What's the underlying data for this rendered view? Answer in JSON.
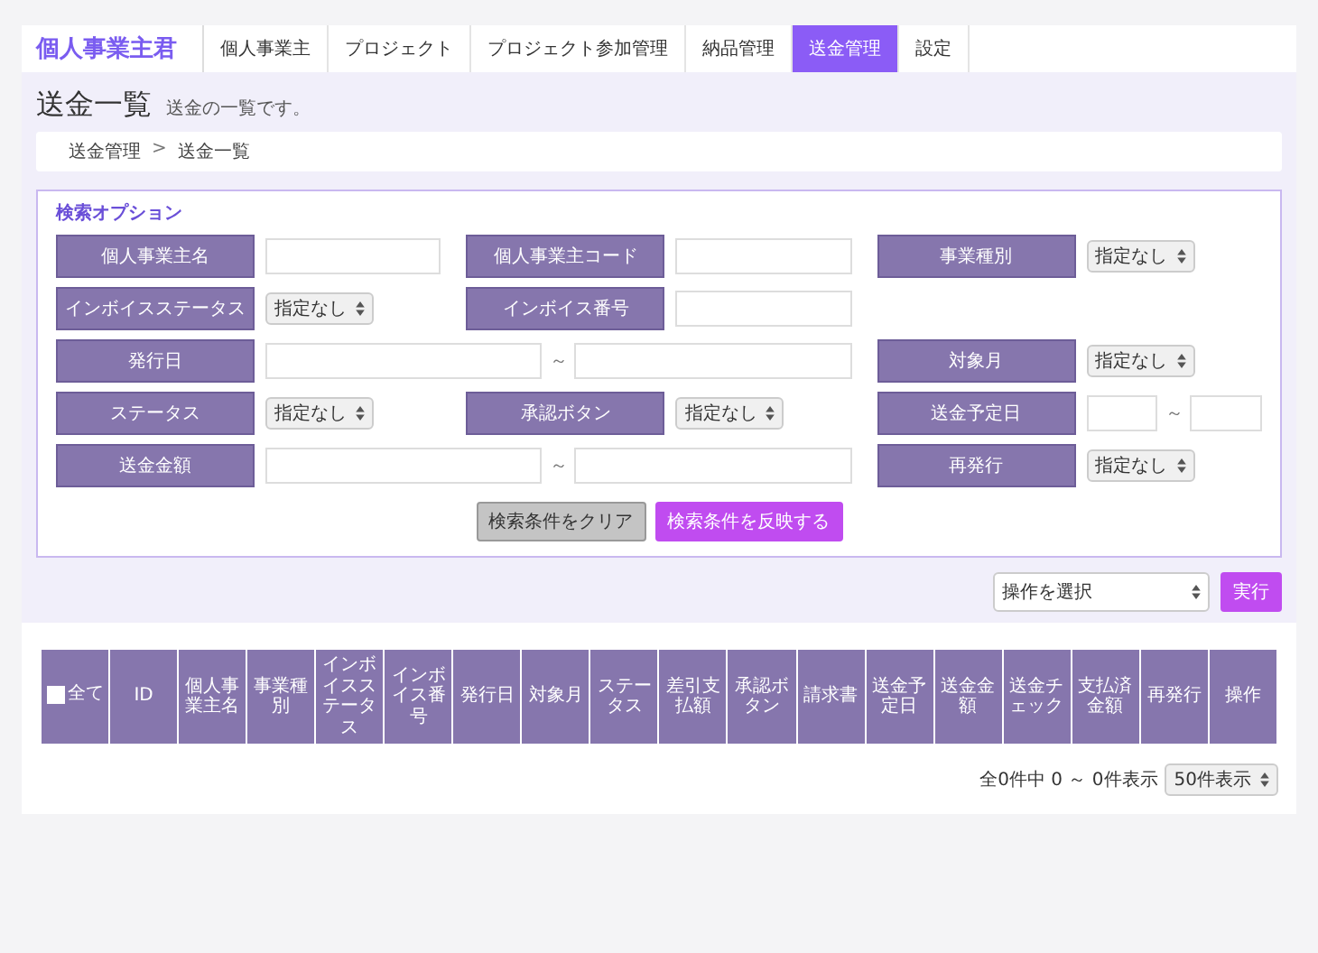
{
  "header": {
    "logo": "個人事業主君",
    "tabs": [
      {
        "label": "個人事業主",
        "selected": false
      },
      {
        "label": "プロジェクト",
        "selected": false
      },
      {
        "label": "プロジェクト参加管理",
        "selected": false
      },
      {
        "label": "納品管理",
        "selected": false
      },
      {
        "label": "送金管理",
        "selected": true
      },
      {
        "label": "設定",
        "selected": false
      }
    ]
  },
  "page": {
    "title": "送金一覧",
    "subtitle": "送金の一覧です。",
    "breadcrumb": [
      "送金管理",
      "送金一覧"
    ],
    "breadcrumb_separator": ">"
  },
  "search": {
    "heading": "検索オプション",
    "rows": [
      [
        {
          "label": "個人事業主名",
          "kind": "text"
        },
        {
          "label": "個人事業主コード",
          "kind": "text"
        },
        {
          "label": "事業種別",
          "kind": "select",
          "value": "指定なし"
        }
      ],
      [
        {
          "label": "インボイスステータス",
          "kind": "select",
          "value": "指定なし"
        },
        {
          "label": "インボイス番号",
          "kind": "text"
        }
      ],
      [
        {
          "label": "発行日",
          "kind": "range",
          "separator": "～"
        },
        {
          "label": "対象月",
          "kind": "select",
          "value": "指定なし"
        }
      ],
      [
        {
          "label": "ステータス",
          "kind": "select",
          "value": "指定なし"
        },
        {
          "label": "承認ボタン",
          "kind": "select",
          "value": "指定なし"
        },
        {
          "label": "送金予定日",
          "kind": "range",
          "separator": "～"
        }
      ],
      [
        {
          "label": "送金金額",
          "kind": "range",
          "separator": "～"
        },
        {
          "label": "再発行",
          "kind": "select",
          "value": "指定なし"
        }
      ]
    ],
    "buttons": [
      {
        "label": "検索条件をクリア",
        "kind": "secondary"
      },
      {
        "label": "検索条件を反映する",
        "kind": "primary"
      }
    ]
  },
  "bulk_action": {
    "select": "操作を選択",
    "button": "実行"
  },
  "table": {
    "select_all": {
      "label": "全て",
      "checked": false
    },
    "columns": [
      "ID",
      "個人事業主名",
      "事業種別",
      "インボイスステータス",
      "インボイス番号",
      "発行日",
      "対象月",
      "ステータス",
      "差引支払額",
      "承認ボタン",
      "請求書",
      "送金予定日",
      "送金金額",
      "送金チェック",
      "支払済金額",
      "再発行",
      "操作"
    ]
  },
  "pagination": {
    "summary": "全0件中 0 ～ 0件表示",
    "page_size": "50件表示"
  }
}
